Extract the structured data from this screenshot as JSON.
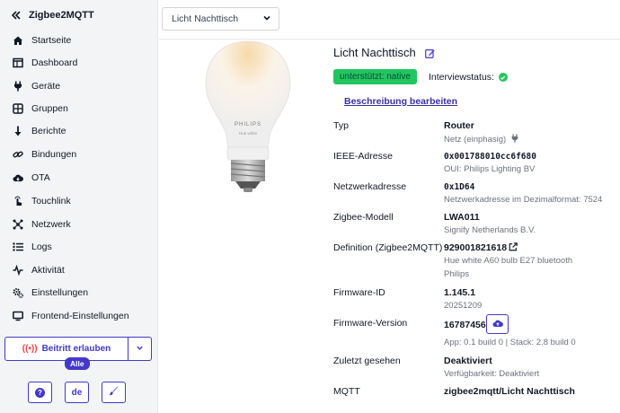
{
  "sidebar": {
    "brand": "Zigbee2MQTT",
    "items": [
      {
        "label": "Startseite",
        "icon": "home-icon"
      },
      {
        "label": "Dashboard",
        "icon": "dashboard-icon"
      },
      {
        "label": "Geräte",
        "icon": "plug-icon"
      },
      {
        "label": "Gruppen",
        "icon": "groups-icon"
      },
      {
        "label": "Berichte",
        "icon": "arrow-down-icon"
      },
      {
        "label": "Bindungen",
        "icon": "link-icon"
      },
      {
        "label": "OTA",
        "icon": "cloud-icon"
      },
      {
        "label": "Touchlink",
        "icon": "touch-icon"
      },
      {
        "label": "Netzwerk",
        "icon": "network-icon"
      },
      {
        "label": "Logs",
        "icon": "list-icon"
      },
      {
        "label": "Aktivität",
        "icon": "activity-icon"
      },
      {
        "label": "Einstellungen",
        "icon": "gears-icon"
      },
      {
        "label": "Frontend-Einstellungen",
        "icon": "monitor-icon"
      }
    ],
    "join_button": "Beitritt erlauben",
    "join_badge": "Alle",
    "bottom": {
      "help": "?",
      "language": "de",
      "theme": "brush"
    }
  },
  "topbar": {
    "device_select": "Licht Nachttisch"
  },
  "device": {
    "name": "Licht Nachttisch",
    "support_badge": "unterstützt: native",
    "interview_label": "Interviewstatus:",
    "description_link": "Beschreibung bearbeiten",
    "image_brand": "PHILIPS",
    "image_sub": "Hue white",
    "rows": {
      "type": {
        "label": "Typ",
        "value": "Router",
        "sub": "Netz (einphasig)"
      },
      "ieee": {
        "label": "IEEE-Adresse",
        "value": "0x001788010cc6f680",
        "sub": "OUI: Philips Lighting BV"
      },
      "network": {
        "label": "Netzwerkadresse",
        "value": "0x1D64",
        "sub": "Netzwerkadresse im Dezimalformat: 7524"
      },
      "model": {
        "label": "Zigbee-Modell",
        "value": "LWA011",
        "sub": "Signify Netherlands B.V."
      },
      "definition": {
        "label": "Definition (Zigbee2MQTT)",
        "value": "929001821618",
        "sub": "Hue white A60 bulb E27 bluetooth",
        "sub2": "Philips"
      },
      "fw_id": {
        "label": "Firmware-ID",
        "value": "1.145.1",
        "sub": "20251209"
      },
      "fw_version": {
        "label": "Firmware-Version",
        "value": "16787456",
        "sub": "App: 0.1 build 0 | Stack: 2.8 build 0"
      },
      "last_seen": {
        "label": "Zuletzt gesehen",
        "value": "Deaktiviert",
        "sub": "Verfügbarkeit: Deaktiviert"
      },
      "mqtt": {
        "label": "MQTT",
        "value": "zigbee2mqtt/Licht Nachttisch"
      }
    }
  },
  "colors": {
    "accent": "#4338ca",
    "success": "#22c55e",
    "sidebar_bg": "#f3f4f6"
  }
}
